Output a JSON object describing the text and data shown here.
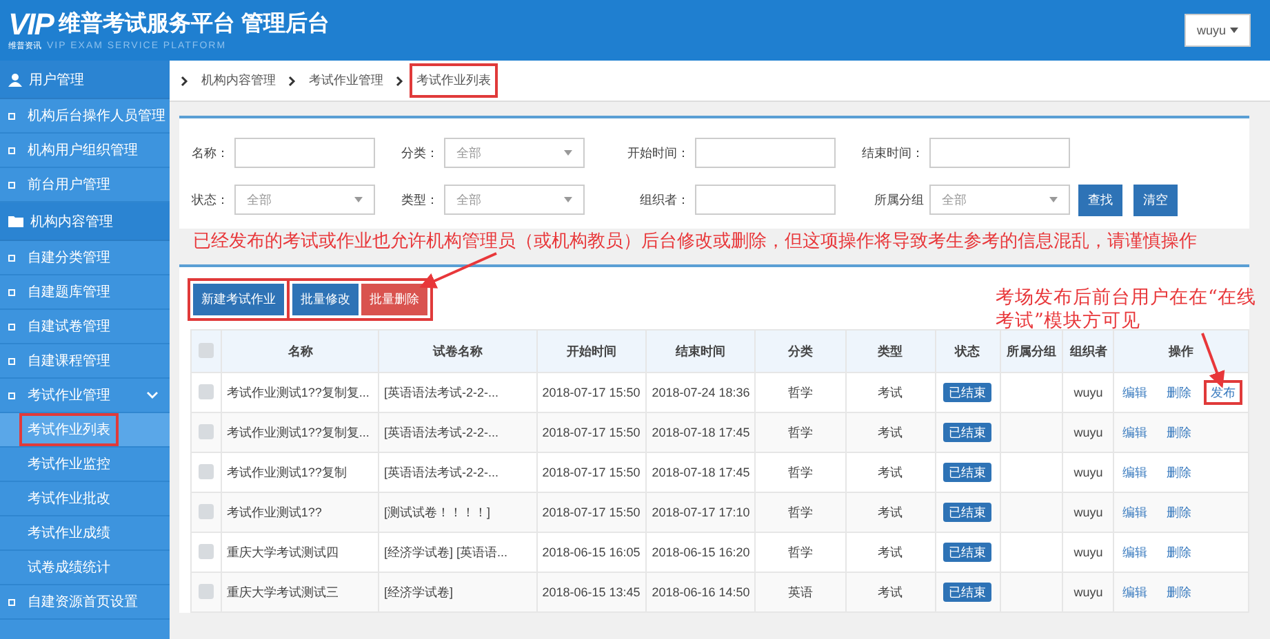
{
  "header": {
    "logo": "VIP",
    "logo_sub": "维普资讯",
    "title": "维普考试服务平台 管理后台",
    "tagline": "VIP EXAM SERVICE PLATFORM",
    "user": "wuyu"
  },
  "sidebar": {
    "sections": [
      {
        "label": "用户管理",
        "items": [
          {
            "label": "机构后台操作人员管理",
            "selected": false
          },
          {
            "label": "机构用户组织管理",
            "selected": false
          },
          {
            "label": "前台用户管理",
            "selected": false
          }
        ]
      },
      {
        "label": "机构内容管理",
        "items": [
          {
            "label": "自建分类管理",
            "selected": false
          },
          {
            "label": "自建题库管理",
            "selected": false
          },
          {
            "label": "自建试卷管理",
            "selected": false
          },
          {
            "label": "自建课程管理",
            "selected": false
          },
          {
            "label": "考试作业管理",
            "selected": false,
            "expanded": true,
            "children": [
              {
                "label": "考试作业列表",
                "selected": true,
                "highlighted": true
              },
              {
                "label": "考试作业监控",
                "selected": false,
                "highlighted": false
              },
              {
                "label": "考试作业批改",
                "selected": false,
                "highlighted": false
              },
              {
                "label": "考试作业成绩",
                "selected": false,
                "highlighted": false
              },
              {
                "label": "试卷成绩统计",
                "selected": false,
                "highlighted": false
              }
            ]
          },
          {
            "label": "自建资源首页设置",
            "selected": false
          }
        ]
      }
    ]
  },
  "breadcrumb": [
    {
      "label": "机构内容管理",
      "highlighted": false
    },
    {
      "label": "考试作业管理",
      "highlighted": false
    },
    {
      "label": "考试作业列表",
      "highlighted": true
    }
  ],
  "filters": [
    [
      {
        "kind": "input",
        "label": "名称："
      },
      {
        "kind": "select",
        "label": "分类：",
        "value": "全部"
      },
      {
        "kind": "input",
        "label": "开始时间："
      },
      {
        "kind": "input",
        "label": "结束时间："
      }
    ],
    [
      {
        "kind": "select",
        "label": "状态：",
        "value": "全部"
      },
      {
        "kind": "select",
        "label": "类型：",
        "value": "全部"
      },
      {
        "kind": "input",
        "label": "组织者："
      },
      {
        "kind": "select",
        "label": "所属分组",
        "value": "全部"
      }
    ]
  ],
  "filter_buttons": [
    "查找",
    "清空"
  ],
  "toolbar": [
    {
      "highlighted": true,
      "buttons": [
        {
          "label": "新建考试作业",
          "kind": "primary"
        }
      ]
    },
    {
      "highlighted": true,
      "buttons": [
        {
          "label": "批量修改",
          "kind": "primary"
        },
        {
          "label": "批量删除",
          "kind": "danger"
        }
      ]
    }
  ],
  "table": {
    "header_checked": false,
    "columns": [
      "名称",
      "试卷名称",
      "开始时间",
      "结束时间",
      "分类",
      "类型",
      "状态",
      "所属分组",
      "组织者",
      "操作"
    ],
    "rows": [
      {
        "checked": false,
        "name": "考试作业测试1??复制复...",
        "paper": "[英语语法考试-2-2-...",
        "start": "2018-07-17 15:50",
        "end": "2018-07-24 18:36",
        "category": "哲学",
        "type": "考试",
        "status": "已结束",
        "group": "",
        "organizer": "wuyu",
        "actions": [
          {
            "label": "编辑",
            "highlighted": false
          },
          {
            "label": "删除",
            "highlighted": false
          },
          {
            "label": "发布",
            "highlighted": true
          }
        ]
      },
      {
        "checked": false,
        "name": "考试作业测试1??复制复...",
        "paper": "[英语语法考试-2-2-...",
        "start": "2018-07-17 15:50",
        "end": "2018-07-18 17:45",
        "category": "哲学",
        "type": "考试",
        "status": "已结束",
        "group": "",
        "organizer": "wuyu",
        "actions": [
          {
            "label": "编辑",
            "highlighted": false
          },
          {
            "label": "删除",
            "highlighted": false
          }
        ]
      },
      {
        "checked": false,
        "name": "考试作业测试1??复制",
        "paper": "[英语语法考试-2-2-...",
        "start": "2018-07-17 15:50",
        "end": "2018-07-18 17:45",
        "category": "哲学",
        "type": "考试",
        "status": "已结束",
        "group": "",
        "organizer": "wuyu",
        "actions": [
          {
            "label": "编辑",
            "highlighted": false
          },
          {
            "label": "删除",
            "highlighted": false
          }
        ]
      },
      {
        "checked": false,
        "name": "考试作业测试1??",
        "paper": "[测试试卷！！！！]",
        "start": "2018-07-17 15:50",
        "end": "2018-07-17 17:10",
        "category": "哲学",
        "type": "考试",
        "status": "已结束",
        "group": "",
        "organizer": "wuyu",
        "actions": [
          {
            "label": "编辑",
            "highlighted": false
          },
          {
            "label": "删除",
            "highlighted": false
          }
        ]
      },
      {
        "checked": false,
        "name": "重庆大学考试测试四",
        "paper": "[经济学试卷] [英语语...",
        "start": "2018-06-15 16:05",
        "end": "2018-06-15 16:20",
        "category": "哲学",
        "type": "考试",
        "status": "已结束",
        "group": "",
        "organizer": "wuyu",
        "actions": [
          {
            "label": "编辑",
            "highlighted": false
          },
          {
            "label": "删除",
            "highlighted": false
          }
        ]
      },
      {
        "checked": false,
        "name": "重庆大学考试测试三",
        "paper": "[经济学试卷]",
        "start": "2018-06-15 13:45",
        "end": "2018-06-16 14:50",
        "category": "英语",
        "type": "考试",
        "status": "已结束",
        "group": "",
        "organizer": "wuyu",
        "actions": [
          {
            "label": "编辑",
            "highlighted": false
          },
          {
            "label": "删除",
            "highlighted": false
          }
        ]
      }
    ]
  },
  "annotations": [
    {
      "text": "已经发布的考试或作业也允许机构管理员（或机构教员）后台修改或删除，但这项操作将导致考生参考的信息混乱，请谨慎操作"
    },
    {
      "text": "考场发布后前台用户在在“在线考试”模块方可见"
    }
  ]
}
